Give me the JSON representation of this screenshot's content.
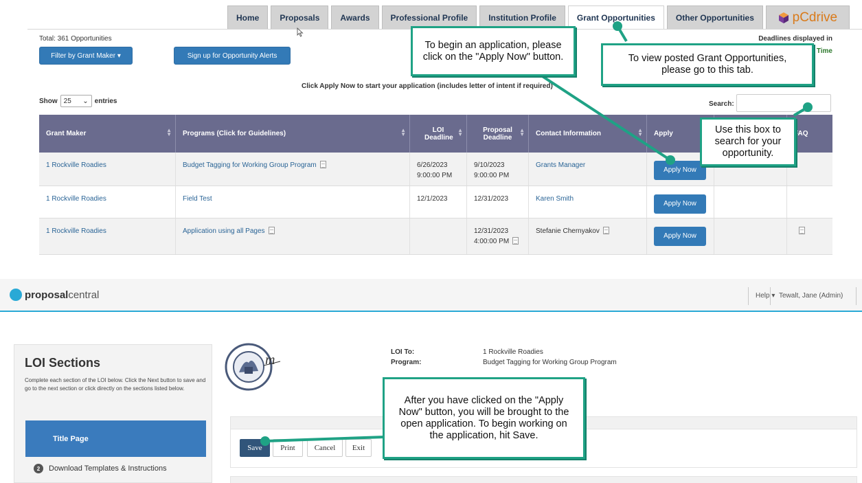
{
  "tabs": [
    {
      "label": "Home",
      "active": false
    },
    {
      "label": "Proposals",
      "active": false
    },
    {
      "label": "Awards",
      "active": false
    },
    {
      "label": "Professional Profile",
      "active": false
    },
    {
      "label": "Institution Profile",
      "active": false
    },
    {
      "label": "Grant Opportunities",
      "active": true
    },
    {
      "label": "Other Opportunities",
      "active": false
    }
  ],
  "pcdrive_label": "pCdrive",
  "opportunities": {
    "total": "Total: 361 Opportunities",
    "filter_button": "Filter by Grant Maker ▾",
    "alerts_button": "Sign up for Opportunity Alerts",
    "deadline_note": "Deadlines displayed in",
    "deadline_note2": "Time",
    "apply_instruction": "Click Apply Now to start your application (includes letter of intent if required)",
    "show_label": "Show",
    "entries_value": "25",
    "entries_label": "entries",
    "search_label": "Search:"
  },
  "table": {
    "headers": [
      "Grant Maker",
      "Programs (Click for Guidelines)",
      "LOI Deadline",
      "Proposal Deadline",
      "Contact Information",
      "Apply",
      "",
      "FAQ"
    ],
    "rows": [
      {
        "grant_maker": "1 Rockville Roadies",
        "program": "Budget Tagging for Working Group Program",
        "loi_date": "6/26/2023",
        "loi_time": "9:00:00 PM",
        "prop_date": "9/10/2023",
        "prop_time": "9:00:00 PM",
        "contact": "Grants Manager",
        "apply": "Apply Now"
      },
      {
        "grant_maker": "1 Rockville Roadies",
        "program": "Field Test",
        "loi_date": "12/1/2023",
        "loi_time": "",
        "prop_date": "12/31/2023",
        "prop_time": "",
        "contact": "Karen Smith",
        "apply": "Apply Now"
      },
      {
        "grant_maker": "1 Rockville Roadies",
        "program": "Application using all Pages",
        "loi_date": "",
        "loi_time": "",
        "prop_date": "12/31/2023",
        "prop_time": "4:00:00 PM",
        "contact": "Stefanie Chernyakov",
        "apply": "Apply Now"
      }
    ]
  },
  "pc_header": {
    "logo_bold": "proposal",
    "logo_light": "central",
    "help": "Help ▾",
    "user": "Tewalt, Jane (Admin)"
  },
  "loi": {
    "title": "LOI Sections",
    "description": "Complete each section of the LOI below. Click the Next button to save and go to the next section or click directly on the sections listed below.",
    "title_page": "Title Page",
    "item2_num": "2",
    "item2_label": "Download Templates & Instructions",
    "loi_to_label": "LOI To:",
    "loi_to_value": "1 Rockville Roadies",
    "program_label": "Program:",
    "program_value": "Budget Tagging for Working Group Program"
  },
  "actions": {
    "save": "Save",
    "print": "Print",
    "cancel": "Cancel",
    "exit": "Exit"
  },
  "callouts": {
    "apply_now": "To begin an application, please click on the \"Apply Now\" button.",
    "grant_tab": "To view posted Grant Opportunities, please go to this tab.",
    "search": "Use this box to search for your opportunity.",
    "save": "After you have clicked on the \"Apply Now\" button, you will be brought to the open application. To begin working on the application, hit Save."
  },
  "colors": {
    "callout_border": "#1fa285",
    "header_purple": "#6a6b8e",
    "button_blue": "#337ab7",
    "pc_blue": "#29a9d6",
    "save_navy": "#31557a"
  }
}
